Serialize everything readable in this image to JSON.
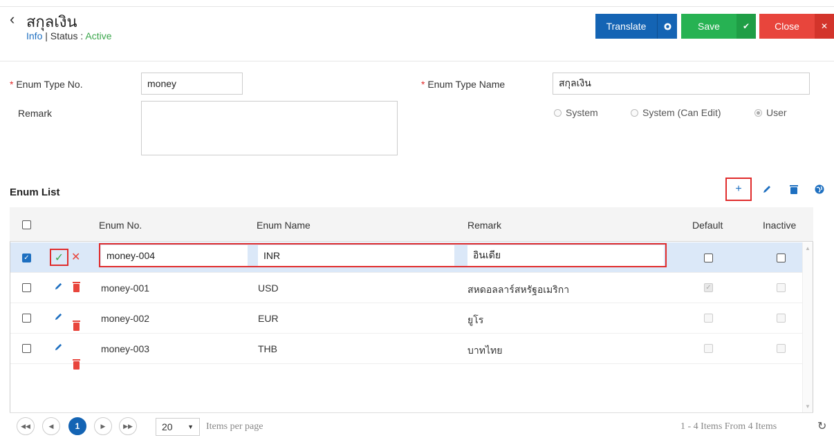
{
  "header": {
    "back_icon": "‹",
    "title": "สกุลเงิน",
    "info_link": "Info",
    "sep": "|",
    "status_label": "Status",
    "status_colon": ":",
    "status_value": "Active"
  },
  "buttons": {
    "translate": "Translate",
    "save": "Save",
    "close": "Close"
  },
  "form": {
    "enum_type_no_label": "Enum Type No.",
    "enum_type_no_value": "money",
    "remark_label": "Remark",
    "remark_value": "",
    "enum_type_name_label": "Enum Type Name",
    "enum_type_name_value": "สกุลเงิน",
    "radios": [
      {
        "label": "System",
        "checked": false
      },
      {
        "label": "System (Can Edit)",
        "checked": false
      },
      {
        "label": "User",
        "checked": true
      }
    ]
  },
  "enum_list": {
    "title": "Enum List",
    "columns": [
      "Enum No.",
      "Enum Name",
      "Remark",
      "Default",
      "Inactive"
    ],
    "edit_row": {
      "enum_no": "money-004",
      "enum_name": "INR",
      "remark": "อินเดีย",
      "default": false,
      "inactive": false
    },
    "rows": [
      {
        "enum_no": "money-001",
        "enum_name": "USD",
        "remark": "สหดอลลาร์สหรัฐอเมริกา",
        "default": true,
        "inactive": false
      },
      {
        "enum_no": "money-002",
        "enum_name": "EUR",
        "remark": "ยูโร",
        "default": false,
        "inactive": false
      },
      {
        "enum_no": "money-003",
        "enum_name": "THB",
        "remark": "บาทไทย",
        "default": false,
        "inactive": false
      }
    ]
  },
  "pager": {
    "current_page": "1",
    "page_size": "20",
    "items_per_page": "Items per page",
    "summary": "1 - 4 Items From 4 Items"
  },
  "colors": {
    "primary": "#1464b4",
    "save": "#27b253",
    "close": "#e8453c",
    "active": "#3aa64b",
    "highlight": "#e02b2b"
  }
}
